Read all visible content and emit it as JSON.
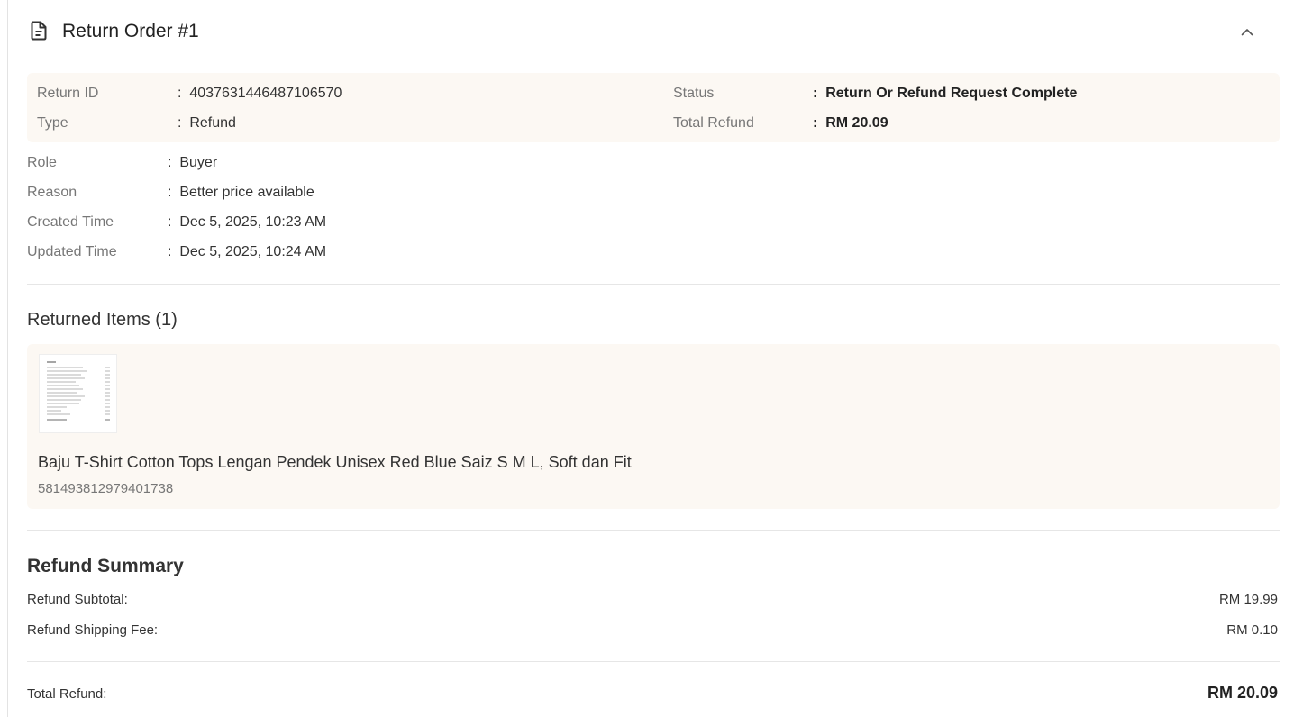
{
  "header": {
    "title": "Return Order #1"
  },
  "summary": {
    "return_id_label": "Return ID",
    "return_id_value": "4037631446487106570",
    "type_label": "Type",
    "type_value": "Refund",
    "status_label": "Status",
    "status_value": "Return Or Refund Request Complete",
    "total_refund_label": "Total Refund",
    "total_refund_value": "RM 20.09"
  },
  "meta": {
    "role_label": "Role",
    "role_value": "Buyer",
    "reason_label": "Reason",
    "reason_value": "Better price available",
    "created_label": "Created Time",
    "created_value": "Dec 5, 2025, 10:23 AM",
    "updated_label": "Updated Time",
    "updated_value": "Dec 5, 2025, 10:24 AM"
  },
  "returned_items": {
    "title": "Returned Items (1)",
    "items": [
      {
        "name": "Baju T-Shirt Cotton Tops Lengan Pendek Unisex Red Blue Saiz S M L, Soft dan Fit",
        "id": "581493812979401738"
      }
    ]
  },
  "refund_summary": {
    "title": "Refund Summary",
    "subtotal_label": "Refund Subtotal:",
    "subtotal_value": "RM 19.99",
    "shipping_label": "Refund Shipping Fee:",
    "shipping_value": "RM 0.10",
    "total_label": "Total Refund:",
    "total_value": "RM 20.09"
  },
  "colors": {
    "panel_bg": "#fcf8f3",
    "divider": "#e6e6e6",
    "label_text": "#777777"
  }
}
